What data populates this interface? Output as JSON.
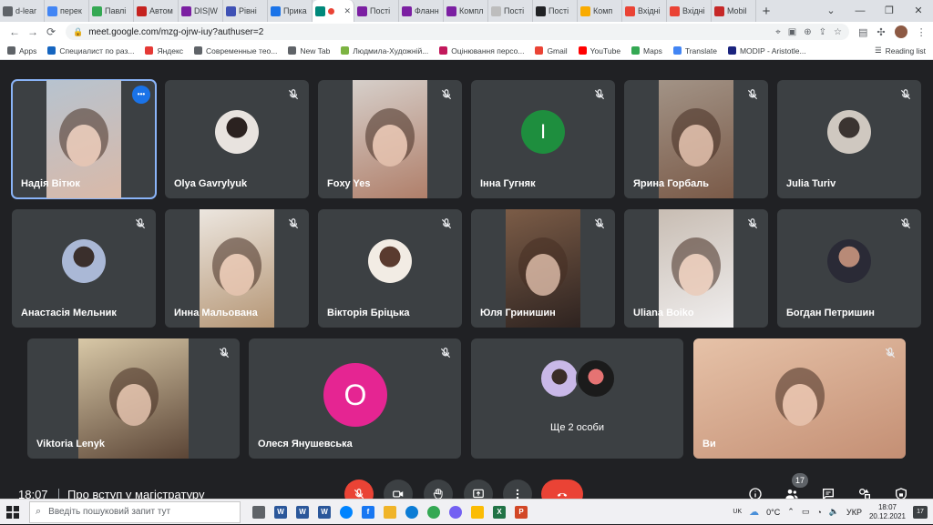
{
  "browser": {
    "tabs": [
      {
        "label": "d-lear",
        "favicon_color": "#5f6368"
      },
      {
        "label": "перек",
        "favicon_color": "#4285f4"
      },
      {
        "label": "Павлі",
        "favicon_color": "#34a853"
      },
      {
        "label": "Автом",
        "favicon_color": "#c5221f"
      },
      {
        "label": "DIS|W",
        "favicon_color": "#7b1fa2"
      },
      {
        "label": "Рівні",
        "favicon_color": "#3f51b5"
      },
      {
        "label": "Прика",
        "favicon_color": "#1a73e8"
      },
      {
        "label": "",
        "favicon_color": "#00897b",
        "active": true
      },
      {
        "label": "Пості",
        "favicon_color": "#7b1fa2"
      },
      {
        "label": "Фланн",
        "favicon_color": "#7b1fa2"
      },
      {
        "label": "Компл",
        "favicon_color": "#7b1fa2"
      },
      {
        "label": "Пості",
        "favicon_color": "#bdbdbd"
      },
      {
        "label": "Пості",
        "favicon_color": "#202124"
      },
      {
        "label": "Комп",
        "favicon_color": "#f9ab00"
      },
      {
        "label": "Вхідні",
        "favicon_color": "#ea4335"
      },
      {
        "label": "Вхідні",
        "favicon_color": "#ea4335"
      },
      {
        "label": "Mobil",
        "favicon_color": "#c62828"
      }
    ],
    "tab_close": "✕",
    "new_tab": "+",
    "url": "meet.google.com/mzg-ojrw-iuy?authuser=2",
    "bookmarks": [
      {
        "label": "Apps",
        "color": "#5f6368"
      },
      {
        "label": "Специалист по раз...",
        "color": "#1565c0"
      },
      {
        "label": "Яндекс",
        "color": "#e53935"
      },
      {
        "label": "Современные тео...",
        "color": "#5f6368"
      },
      {
        "label": "New Tab",
        "color": "#5f6368"
      },
      {
        "label": "Людмила-Художній...",
        "color": "#7cb342"
      },
      {
        "label": "Оцінювання персо...",
        "color": "#c2185b"
      },
      {
        "label": "Gmail",
        "color": "#ea4335"
      },
      {
        "label": "YouTube",
        "color": "#ff0000"
      },
      {
        "label": "Maps",
        "color": "#34a853"
      },
      {
        "label": "Translate",
        "color": "#4285f4"
      },
      {
        "label": "MODIP - Aristotle...",
        "color": "#1a237e"
      }
    ],
    "reading_list": "Reading list"
  },
  "participants": [
    {
      "name": "Надія Вітюк",
      "kind": "video",
      "video_colors": [
        "#b7c3cf",
        "#d9b9a8"
      ],
      "speaking": true
    },
    {
      "name": "Olya Gavrylyuk",
      "kind": "avatar",
      "avatar_colors": [
        "#e8e3df",
        "#2b2220"
      ]
    },
    {
      "name": "Foxy Yes",
      "kind": "video",
      "video_colors": [
        "#d6cfca",
        "#b07f6a"
      ]
    },
    {
      "name": "Інна Гугняк",
      "kind": "letter",
      "letter": "I",
      "letter_color": "#1e8e3e"
    },
    {
      "name": "Ярина Горбаль",
      "kind": "video",
      "video_colors": [
        "#a29386",
        "#7a5a48"
      ]
    },
    {
      "name": "Julia Turiv",
      "kind": "avatar",
      "avatar_colors": [
        "#cfc8c0",
        "#3b3431"
      ]
    },
    {
      "name": "Анастасія Мельник",
      "kind": "avatar",
      "avatar_colors": [
        "#aab8d6",
        "#3a2f2c"
      ]
    },
    {
      "name": "Инна Мальована",
      "kind": "video",
      "video_colors": [
        "#ece6df",
        "#b59675"
      ]
    },
    {
      "name": "Вікторія Бріцька",
      "kind": "avatar",
      "avatar_colors": [
        "#f2ece4",
        "#5a3b2f"
      ]
    },
    {
      "name": "Юля Гринишин",
      "kind": "video",
      "video_colors": [
        "#7b5c47",
        "#2e2320"
      ]
    },
    {
      "name": "Uliana Boiko",
      "kind": "video",
      "video_colors": [
        "#c8bdb3",
        "#f0eeee"
      ]
    },
    {
      "name": "Богдан Петришин",
      "kind": "avatar",
      "avatar_colors": [
        "#2a2a36",
        "#b88a77"
      ]
    },
    {
      "name": "Viktoria Lenyk",
      "kind": "video",
      "video_colors": [
        "#d8c8a7",
        "#5b4536"
      ]
    },
    {
      "name": "Олеся Янушевська",
      "kind": "letter",
      "letter": "О",
      "letter_color": "#e52592"
    },
    {
      "name": "Ще 2 особи",
      "kind": "group"
    },
    {
      "name": "Ви",
      "kind": "video",
      "video_colors": [
        "#e6c2a8",
        "#c48f74"
      ]
    }
  ],
  "more_options_label": "•••",
  "meeting": {
    "time": "18:07",
    "title": "Про вступ у магістратуру",
    "people_count": "17"
  },
  "taskbar": {
    "search_placeholder": "Введіть пошуковий запит тут",
    "lang_top": "UK",
    "lang": "УКР",
    "temperature": "0°C",
    "time": "18:07",
    "date": "20.12.2021",
    "notifications": "17",
    "apps": [
      {
        "name": "task-view",
        "label": "",
        "color": "#5f6368"
      },
      {
        "name": "word-1",
        "label": "W",
        "color": "#2b579a"
      },
      {
        "name": "word-2",
        "label": "W",
        "color": "#2b579a"
      },
      {
        "name": "word-3",
        "label": "W",
        "color": "#2b579a"
      },
      {
        "name": "messenger",
        "label": "",
        "color": "#0084ff"
      },
      {
        "name": "facebook",
        "label": "f",
        "color": "#1877f2"
      },
      {
        "name": "file-explorer",
        "label": "",
        "color": "#f0b429"
      },
      {
        "name": "edge",
        "label": "",
        "color": "#0c7cd5"
      },
      {
        "name": "chrome",
        "label": "",
        "color": "#34a853"
      },
      {
        "name": "viber",
        "label": "",
        "color": "#7360f2"
      },
      {
        "name": "security",
        "label": "",
        "color": "#fbbc04"
      },
      {
        "name": "excel",
        "label": "X",
        "color": "#217346"
      },
      {
        "name": "powerpoint",
        "label": "P",
        "color": "#d24726"
      }
    ]
  }
}
